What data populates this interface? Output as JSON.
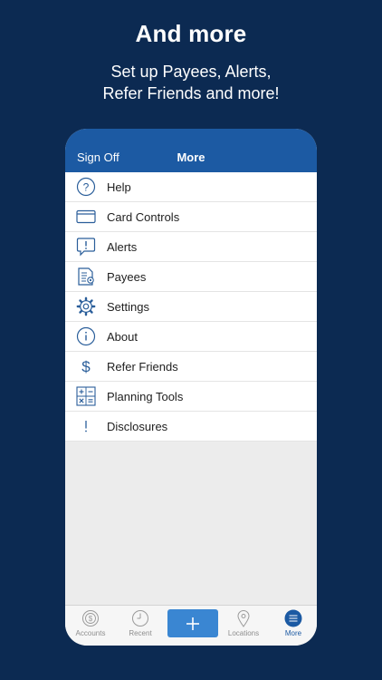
{
  "hero": {
    "title": "And more",
    "subtitle_line1": "Set up Payees, Alerts,",
    "subtitle_line2": "Refer Friends and more!"
  },
  "header": {
    "sign_off": "Sign Off",
    "title": "More"
  },
  "menu": [
    {
      "label": "Help",
      "icon": "help-icon"
    },
    {
      "label": "Card Controls",
      "icon": "card-icon"
    },
    {
      "label": "Alerts",
      "icon": "alert-icon"
    },
    {
      "label": "Payees",
      "icon": "payees-icon"
    },
    {
      "label": "Settings",
      "icon": "gear-icon"
    },
    {
      "label": "About",
      "icon": "info-icon"
    },
    {
      "label": "Refer Friends",
      "icon": "dollar-icon"
    },
    {
      "label": "Planning Tools",
      "icon": "calculator-icon"
    },
    {
      "label": "Disclosures",
      "icon": "exclamation-icon"
    }
  ],
  "tabs": {
    "accounts": "Accounts",
    "recent": "Recent",
    "add": "+",
    "locations": "Locations",
    "more": "More",
    "active": "More"
  },
  "colors": {
    "background": "#0c2a52",
    "header": "#1c5aa3",
    "accent": "#3a86d2",
    "icon": "#2a5e9a"
  }
}
